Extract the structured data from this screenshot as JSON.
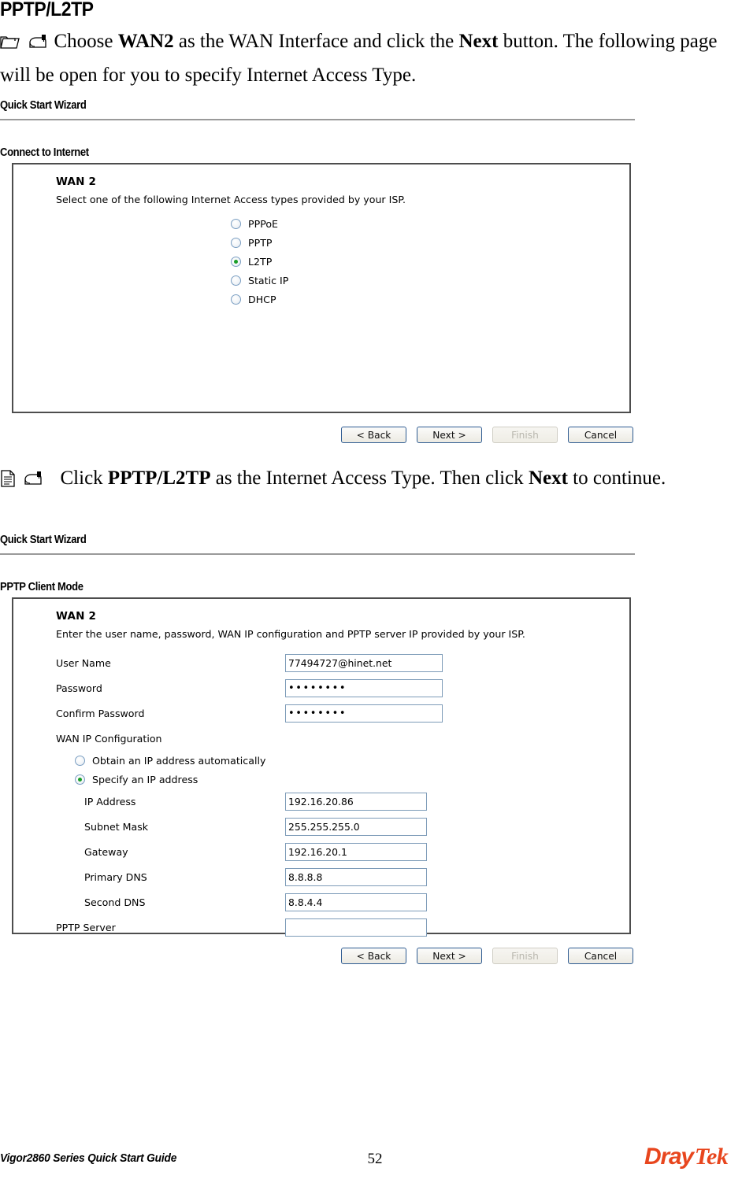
{
  "document": {
    "heading": "PPTP/L2TP",
    "footer_left": "Vigor2860 Series Quick Start Guide",
    "page_number": "52",
    "logo_part1": "Dray",
    "logo_part2": "Tek",
    "logo_color": "#E8461E"
  },
  "steps": [
    {
      "marker_icons": [
        "folder-icon",
        "mailbox-icon"
      ],
      "text_parts": [
        {
          "t": "Choose ",
          "bold": false
        },
        {
          "t": "WAN2",
          "bold": true
        },
        {
          "t": " as the WAN Interface and click the ",
          "bold": false
        },
        {
          "t": "Next",
          "bold": true
        },
        {
          "t": " button. The following page will be open for you to specify Internet Access Type.",
          "bold": false
        }
      ]
    },
    {
      "marker_icons": [
        "document-icon",
        "mailbox-icon"
      ],
      "text_parts": [
        {
          "t": "Click ",
          "bold": false
        },
        {
          "t": "PPTP/L2TP",
          "bold": true
        },
        {
          "t": " as the Internet Access Type. Then click ",
          "bold": false
        },
        {
          "t": "Next",
          "bold": true
        },
        {
          "t": " to continue.",
          "bold": false
        }
      ]
    }
  ],
  "wizard1": {
    "title": "Quick Start Wizard",
    "section_label": "Connect to Internet",
    "wan_title": "WAN 2",
    "wan_desc": "Select one of the following Internet Access types provided by your ISP.",
    "access_types": [
      {
        "label": "PPPoE",
        "checked": false
      },
      {
        "label": "PPTP",
        "checked": false
      },
      {
        "label": "L2TP",
        "checked": true
      },
      {
        "label": "Static IP",
        "checked": false
      },
      {
        "label": "DHCP",
        "checked": false
      }
    ],
    "buttons": [
      {
        "label": "< Back",
        "disabled": false
      },
      {
        "label": "Next >",
        "disabled": false
      },
      {
        "label": "Finish",
        "disabled": true
      },
      {
        "label": "Cancel",
        "disabled": false
      }
    ]
  },
  "wizard2": {
    "title": "Quick Start Wizard",
    "section_label": "PPTP Client Mode",
    "wan_title": "WAN 2",
    "wan_desc": "Enter the user name, password, WAN IP configuration and PPTP server IP provided by your ISP.",
    "fields": [
      {
        "label": "User Name",
        "value": "77494727@hinet.net",
        "masked": false,
        "width": "wide",
        "indent": 0
      },
      {
        "label": "Password",
        "value": "••••••••",
        "masked": true,
        "width": "wide",
        "indent": 0
      },
      {
        "label": "Confirm Password",
        "value": "••••••••",
        "masked": true,
        "width": "wide",
        "indent": 0
      }
    ],
    "wan_ip_config_label": "WAN IP Configuration",
    "ip_mode_options": [
      {
        "label": "Obtain an IP address automatically",
        "checked": false
      },
      {
        "label": "Specify an IP address",
        "checked": true
      }
    ],
    "ip_fields": [
      {
        "label": "IP Address",
        "value": "192.16.20.86",
        "width": "narrow",
        "indent": 2
      },
      {
        "label": "Subnet Mask",
        "value": "255.255.255.0",
        "width": "narrow",
        "indent": 2
      },
      {
        "label": "Gateway",
        "value": "192.16.20.1",
        "width": "narrow",
        "indent": 2
      },
      {
        "label": "Primary DNS",
        "value": "8.8.8.8",
        "width": "narrow",
        "indent": 2
      },
      {
        "label": "Second DNS",
        "value": "8.8.4.4",
        "width": "narrow",
        "indent": 2
      },
      {
        "label": "PPTP Server",
        "value": "",
        "width": "narrow",
        "indent": 0
      }
    ],
    "buttons": [
      {
        "label": "< Back",
        "disabled": false
      },
      {
        "label": "Next >",
        "disabled": false
      },
      {
        "label": "Finish",
        "disabled": true
      },
      {
        "label": "Cancel",
        "disabled": false
      }
    ]
  }
}
